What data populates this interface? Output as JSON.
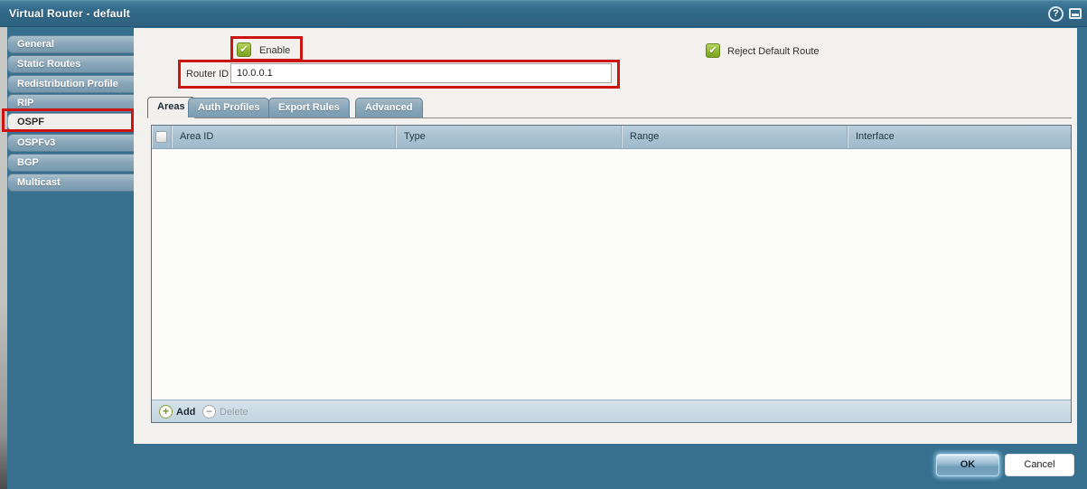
{
  "window": {
    "title": "Virtual Router - default",
    "help_glyph": "?"
  },
  "sidebar": {
    "items": [
      {
        "label": "General"
      },
      {
        "label": "Static Routes"
      },
      {
        "label": "Redistribution Profile"
      },
      {
        "label": "RIP"
      },
      {
        "label": "OSPF"
      },
      {
        "label": "OSPFv3"
      },
      {
        "label": "BGP"
      },
      {
        "label": "Multicast"
      }
    ],
    "selected": "OSPF"
  },
  "form": {
    "enable": {
      "label": "Enable",
      "checked": true,
      "check_glyph": "✔"
    },
    "reject_default_route": {
      "label": "Reject Default Route",
      "checked": true,
      "check_glyph": "✔"
    },
    "router_id": {
      "label": "Router ID",
      "value": "10.0.0.1"
    }
  },
  "tabs": [
    {
      "label": "Areas",
      "active": true
    },
    {
      "label": "Auth Profiles",
      "active": false
    },
    {
      "label": "Export Rules",
      "active": false
    },
    {
      "label": "Advanced",
      "active": false
    }
  ],
  "table": {
    "columns": [
      "Area ID",
      "Type",
      "Range",
      "Interface"
    ],
    "rows": [],
    "footer": {
      "add_label": "Add",
      "add_glyph": "+",
      "delete_label": "Delete",
      "delete_glyph": "−",
      "delete_enabled": false
    }
  },
  "buttons": {
    "ok": "OK",
    "cancel": "Cancel"
  },
  "colors": {
    "chrome_teal": "#336a8a",
    "annotation_red": "#cc1510",
    "checkbox_green": "#8db32f",
    "table_header": "#a9c2d2"
  }
}
